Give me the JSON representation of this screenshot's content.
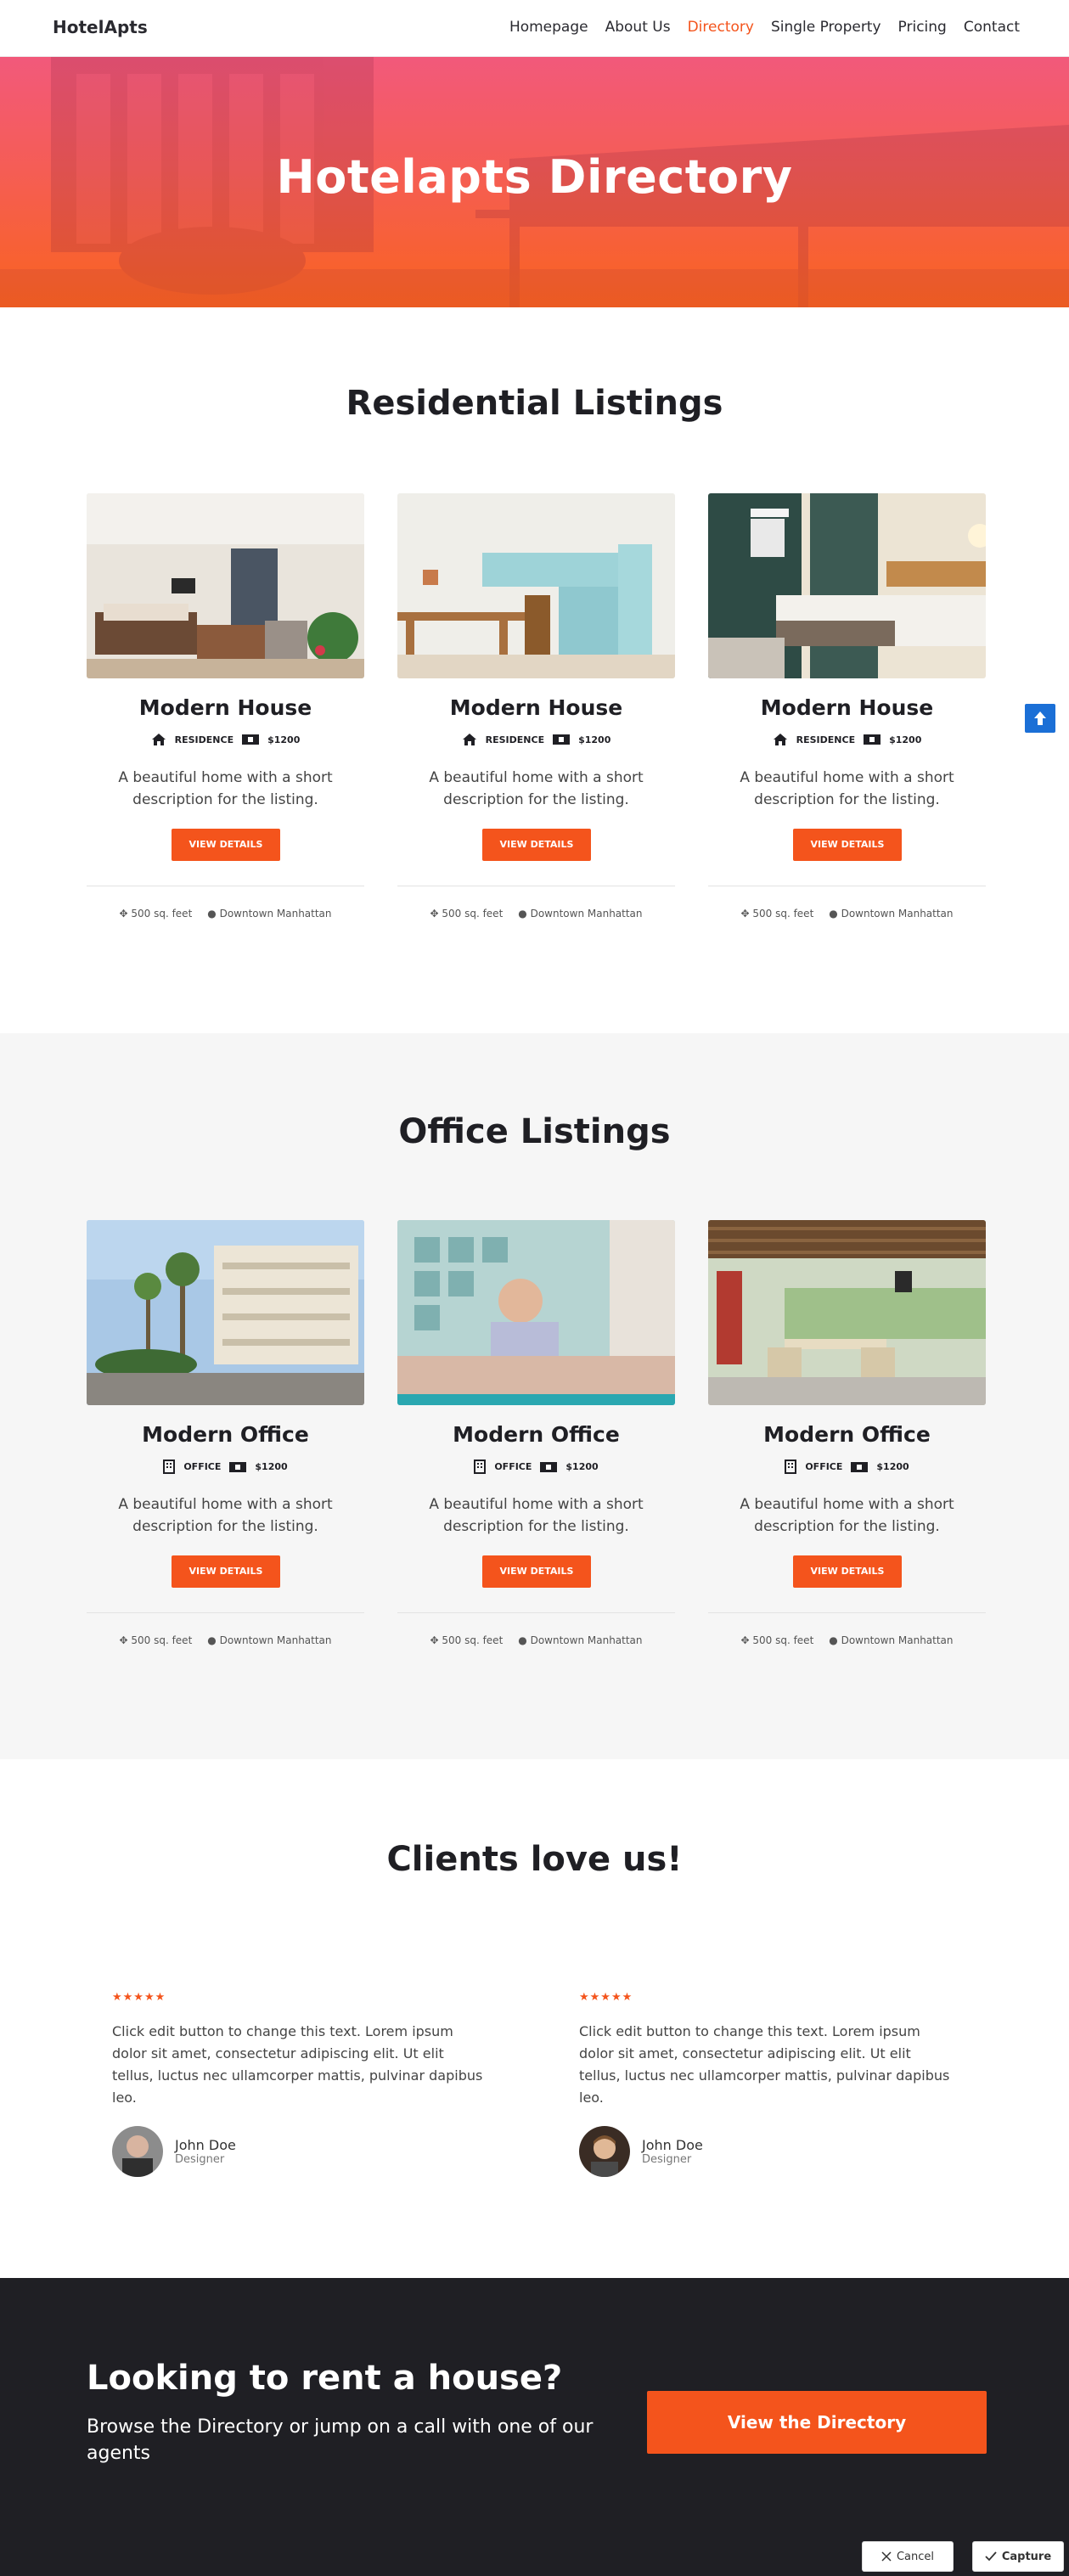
{
  "header": {
    "logo": "HotelApts",
    "nav": [
      "Homepage",
      "About Us",
      "Directory",
      "Single Property",
      "Pricing",
      "Contact"
    ],
    "active_nav": "Directory"
  },
  "hero": {
    "title": "Hotelapts Directory"
  },
  "residential": {
    "title": "Residential Listings",
    "cards": [
      {
        "title": "Modern House",
        "type": "RESIDENCE",
        "price": "$1200",
        "desc": "A beautiful home with a short description for the listing.",
        "button": "VIEW DETAILS",
        "area": "500 sq. feet",
        "location": "Downtown Manhattan"
      },
      {
        "title": "Modern House",
        "type": "RESIDENCE",
        "price": "$1200",
        "desc": "A beautiful home with a short description for the listing.",
        "button": "VIEW DETAILS",
        "area": "500 sq. feet",
        "location": "Downtown Manhattan"
      },
      {
        "title": "Modern House",
        "type": "RESIDENCE",
        "price": "$1200",
        "desc": "A beautiful home with a short description for the listing.",
        "button": "VIEW DETAILS",
        "area": "500 sq. feet",
        "location": "Downtown Manhattan"
      }
    ]
  },
  "office": {
    "title": "Office Listings",
    "cards": [
      {
        "title": "Modern Office",
        "type": "OFFICE",
        "price": "$1200",
        "desc": "A beautiful home with a short description for the listing.",
        "button": "VIEW DETAILS",
        "area": "500 sq. feet",
        "location": "Downtown Manhattan"
      },
      {
        "title": "Modern Office",
        "type": "OFFICE",
        "price": "$1200",
        "desc": "A beautiful home with a short description for the listing.",
        "button": "VIEW DETAILS",
        "area": "500 sq. feet",
        "location": "Downtown Manhattan"
      },
      {
        "title": "Modern Office",
        "type": "OFFICE",
        "price": "$1200",
        "desc": "A beautiful home with a short description for the listing.",
        "button": "VIEW DETAILS",
        "area": "500 sq. feet",
        "location": "Downtown Manhattan"
      }
    ]
  },
  "testimonials": {
    "title": "Clients love us!",
    "items": [
      {
        "stars": "★★★★★",
        "text": "Click edit button to change this text. Lorem ipsum dolor sit amet, consectetur adipiscing elit. Ut elit tellus, luctus nec ullamcorper mattis, pulvinar dapibus leo.",
        "name": "John Doe",
        "role": "Designer"
      },
      {
        "stars": "★★★★★",
        "text": "Click edit button to change this text. Lorem ipsum dolor sit amet, consectetur adipiscing elit. Ut elit tellus, luctus nec ullamcorper mattis, pulvinar dapibus leo.",
        "name": "John Doe",
        "role": "Designer"
      }
    ]
  },
  "cta": {
    "title": "Looking to rent a house?",
    "subtitle": "Browse the Directory or jump on a call with one of our agents",
    "button": "View the Directory"
  },
  "actions": {
    "cancel": "Cancel",
    "capture": "Capture"
  },
  "colors": {
    "accent": "#f4541c",
    "dark": "#1f1f24",
    "scroll_button": "#1b6fd6"
  }
}
